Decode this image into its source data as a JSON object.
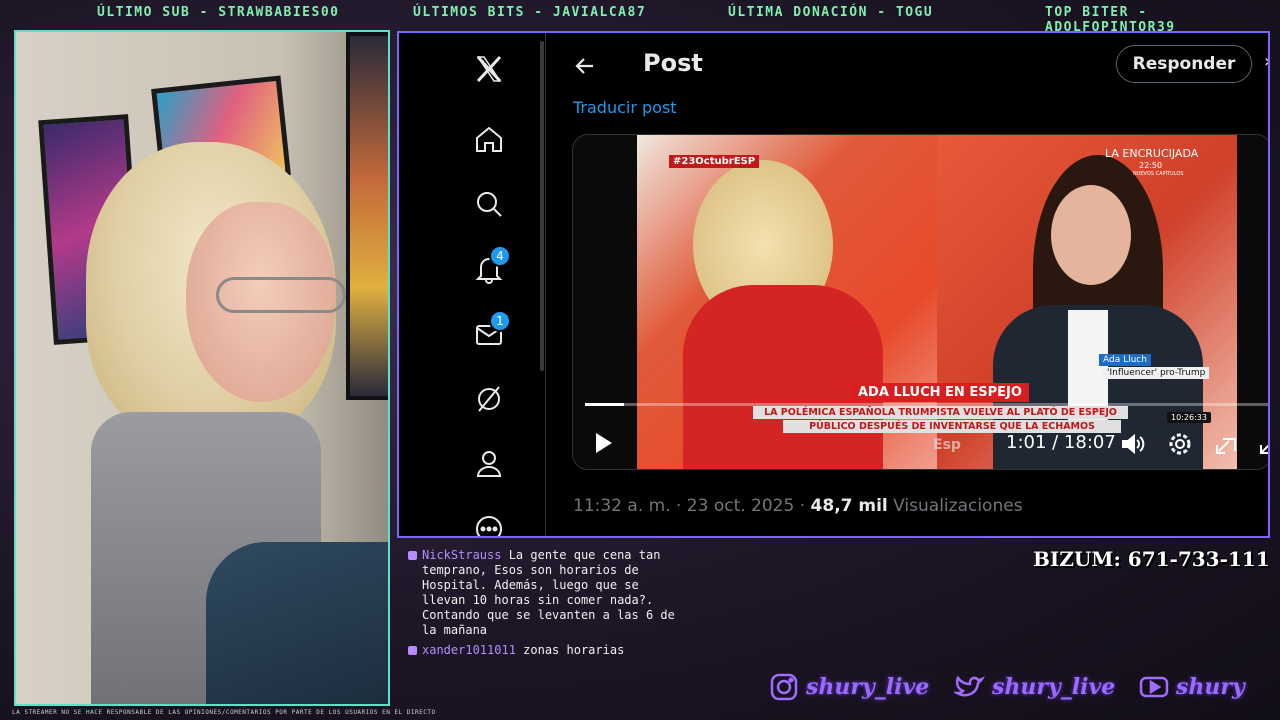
{
  "ticker": {
    "last_sub": "ÚLTIMO SUB - STRAWBABIES00",
    "last_bits": "ÚLTIMOS BITS - JAVIALCA87",
    "last_donation": "ÚLTIMA DONACIÓN - TOGU",
    "top_biter": "TOP BITER - ADOLFOPINTOR39"
  },
  "disclaimer": "LA STREAMER NO SE HACE RESPONSABLE DE LAS OPINIONES/COMENTARIOS POR PARTE DE LOS USUARIOS EN EL DIRECTO",
  "x": {
    "sidebar": {
      "items": [
        {
          "name": "x-logo-icon"
        },
        {
          "name": "home-icon"
        },
        {
          "name": "search-icon"
        },
        {
          "name": "notifications-icon",
          "badge": "4"
        },
        {
          "name": "messages-icon",
          "badge": "1"
        },
        {
          "name": "grok-icon"
        },
        {
          "name": "profile-icon"
        },
        {
          "name": "more-icon"
        }
      ]
    },
    "header": {
      "title": "Post",
      "reply_label": "Responder",
      "more_glyph": "›"
    },
    "translate_label": "Traducir post",
    "video": {
      "hashtag": "#23OctubrESP",
      "show_name": "LA ENCRUCIJADA",
      "show_time": "22:50",
      "show_sub": "NUEVOS CAPÍTULOS",
      "lower_title": "ADA LLUCH EN ESPEJO",
      "lower_line1": "LA POLÉMICA ESPAÑOLA TRUMPISTA VUELVE AL PLATÓ DE ESPEJO",
      "lower_line2": "PÚBLICO DESPUÉS DE INVENTARSE QUE LA ECHAMOS",
      "name_tag": "Ada Lluch",
      "name_sub": "'Influencer' pro-Trump",
      "clock": "10:26:33",
      "channel": "Esp",
      "time": "1:01 / 18:07",
      "progress": 0.056
    },
    "meta": {
      "timestamp": "11:32 a. m. · 23 oct. 2025 · ",
      "views_count": "48,7 mil",
      "views_label": " Visualizaciones"
    }
  },
  "chat": {
    "messages": [
      {
        "user": "NickStrauss",
        "text": " La gente que cena tan temprano, Esos son horarios de Hospital. Además, luego que se llevan 10 horas sin comer nada?. Contando que se levanten a las 6 de la mañana"
      },
      {
        "user": "xander1011011",
        "text": " zonas horarias"
      }
    ]
  },
  "bizum": "BIZUM: 671-733-111",
  "socials": [
    {
      "icon": "instagram-icon",
      "handle": "shury_live"
    },
    {
      "icon": "twitter-icon",
      "handle": "shury_live"
    },
    {
      "icon": "youtube-icon",
      "handle": "shury"
    }
  ],
  "colors": {
    "ticker": "#7ff0b0",
    "x_accent": "#1d9bf0",
    "window_border": "#7f63ff",
    "cam_border": "#5fe0c8",
    "social": "#9b6bff"
  }
}
